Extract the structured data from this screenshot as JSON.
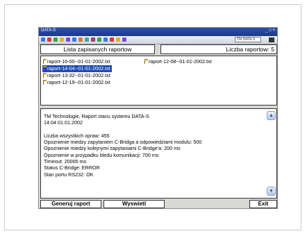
{
  "window": {
    "app_title": "DATA-S",
    "toolbar_field": "TM DATA-S"
  },
  "header": {
    "list_title": "Lista zapisanych raportow",
    "count_label": "Liczba raportow: 5"
  },
  "files": {
    "column1": [
      "raport-16-00--01-01-2002.txt",
      "raport-14-04--01-01-2002.txt",
      "raport-13-32--01-01-2002.txt",
      "raport-12-19--01-01-2002.txt"
    ],
    "column2": [
      "raport-12-08--01-01-2002.txt"
    ],
    "selected": "raport-14-04--01-01-2002.txt"
  },
  "report": {
    "lines": [
      "TM Technologie, Raport stanu systemu DATA-S",
      "14:04  01.01.2002",
      "",
      "Liczba wszystkich opraw: 455",
      "Opoznienie miedzy zapytaniem C-Bridga a odpowiedziami modulu: 500",
      "Opoznienie miedzy kolejnymi zapytaniami C-Bridge'a: 200 ms",
      "Opoznienie w przypadku bledu komunikacji: 700 ms",
      "Timeout: 20000 ms",
      "Status C-Bridge: ERROR",
      "Stan portu RS232: OK"
    ]
  },
  "buttons": {
    "generate": "Generuj raport",
    "show": "Wyswietl",
    "exit": "Exit"
  },
  "colors": {
    "selection": "#1f4bb5",
    "titlebar": "#2b4fa8",
    "device_bg": "#d8d8d4"
  }
}
